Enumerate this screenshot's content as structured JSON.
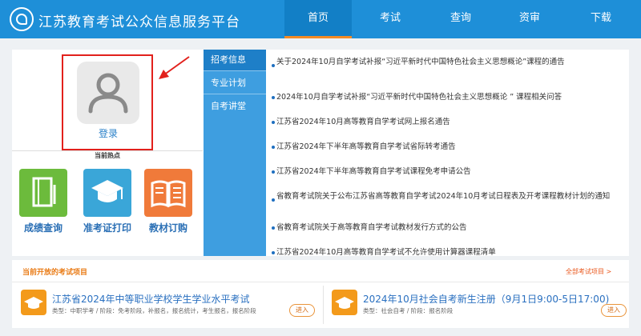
{
  "header": {
    "site_title": "江苏教育考试公众信息服务平台",
    "nav": [
      {
        "label": "首页",
        "active": true
      },
      {
        "label": "考试",
        "active": false
      },
      {
        "label": "查询",
        "active": false
      },
      {
        "label": "资审",
        "active": false
      },
      {
        "label": "下载",
        "active": false
      }
    ]
  },
  "login": {
    "label": "登录"
  },
  "hot": {
    "label": "当前热点",
    "items": [
      {
        "label": "成绩查询",
        "icon": "book-icon",
        "color": "#6cbb3c"
      },
      {
        "label": "准考证打印",
        "icon": "graduation-cap-icon",
        "color": "#3aa6d8"
      },
      {
        "label": "教材订购",
        "icon": "open-book-icon",
        "color": "#f07a3a"
      }
    ]
  },
  "tabs": [
    "招考信息",
    "专业计划",
    "自考讲堂"
  ],
  "news": [
    "关于2024年10月自学考试补报“习近平新时代中国特色社会主义思想概论”课程的通告",
    "2024年10月自学考试补报“习近平新时代中国特色社会主义思想概论 ” 课程相关问答",
    "江苏省2024年10月高等教育自学考试网上报名通告",
    "江苏省2024年下半年高等教育自学考试省际转考通告",
    "江苏省2024年下半年高等教育自学考试课程免考申请公告",
    "省教育考试院关于公布江苏省高等教育自学考试2024年10月考试日程表及开考课程教材计划的通知",
    "省教育考试院关于高等教育自学考试教材发行方式的公告",
    "江苏省2024年10月高等教育自学考试不允许使用计算器课程清单"
  ],
  "exams": {
    "title": "当前开放的考试项目",
    "all_link": "全部考试项目 >",
    "items": [
      {
        "name": "江苏省2024年中等职业学校学生学业水平考试",
        "meta": "类型：中职学考 / 阶段：免考阶段，补报名，报名统计，考生报名，报名阶段",
        "button": "进入"
      },
      {
        "name": "2024年10月社会自考新生注册（9月1日9:00-5日17:00)",
        "meta": "类型：社会自考 / 阶段：报名阶段",
        "button": "进入"
      }
    ]
  },
  "colors": {
    "header_bg": "#1e8fd8",
    "nav_active_bg": "#127fc6",
    "nav_active_border": "#f38a24",
    "tab_col_bg": "#3e9ee0",
    "tab_active_bg": "#1e7fc8",
    "highlight_frame": "#e2211c",
    "exam_icon_bg": "#f39a1b"
  }
}
